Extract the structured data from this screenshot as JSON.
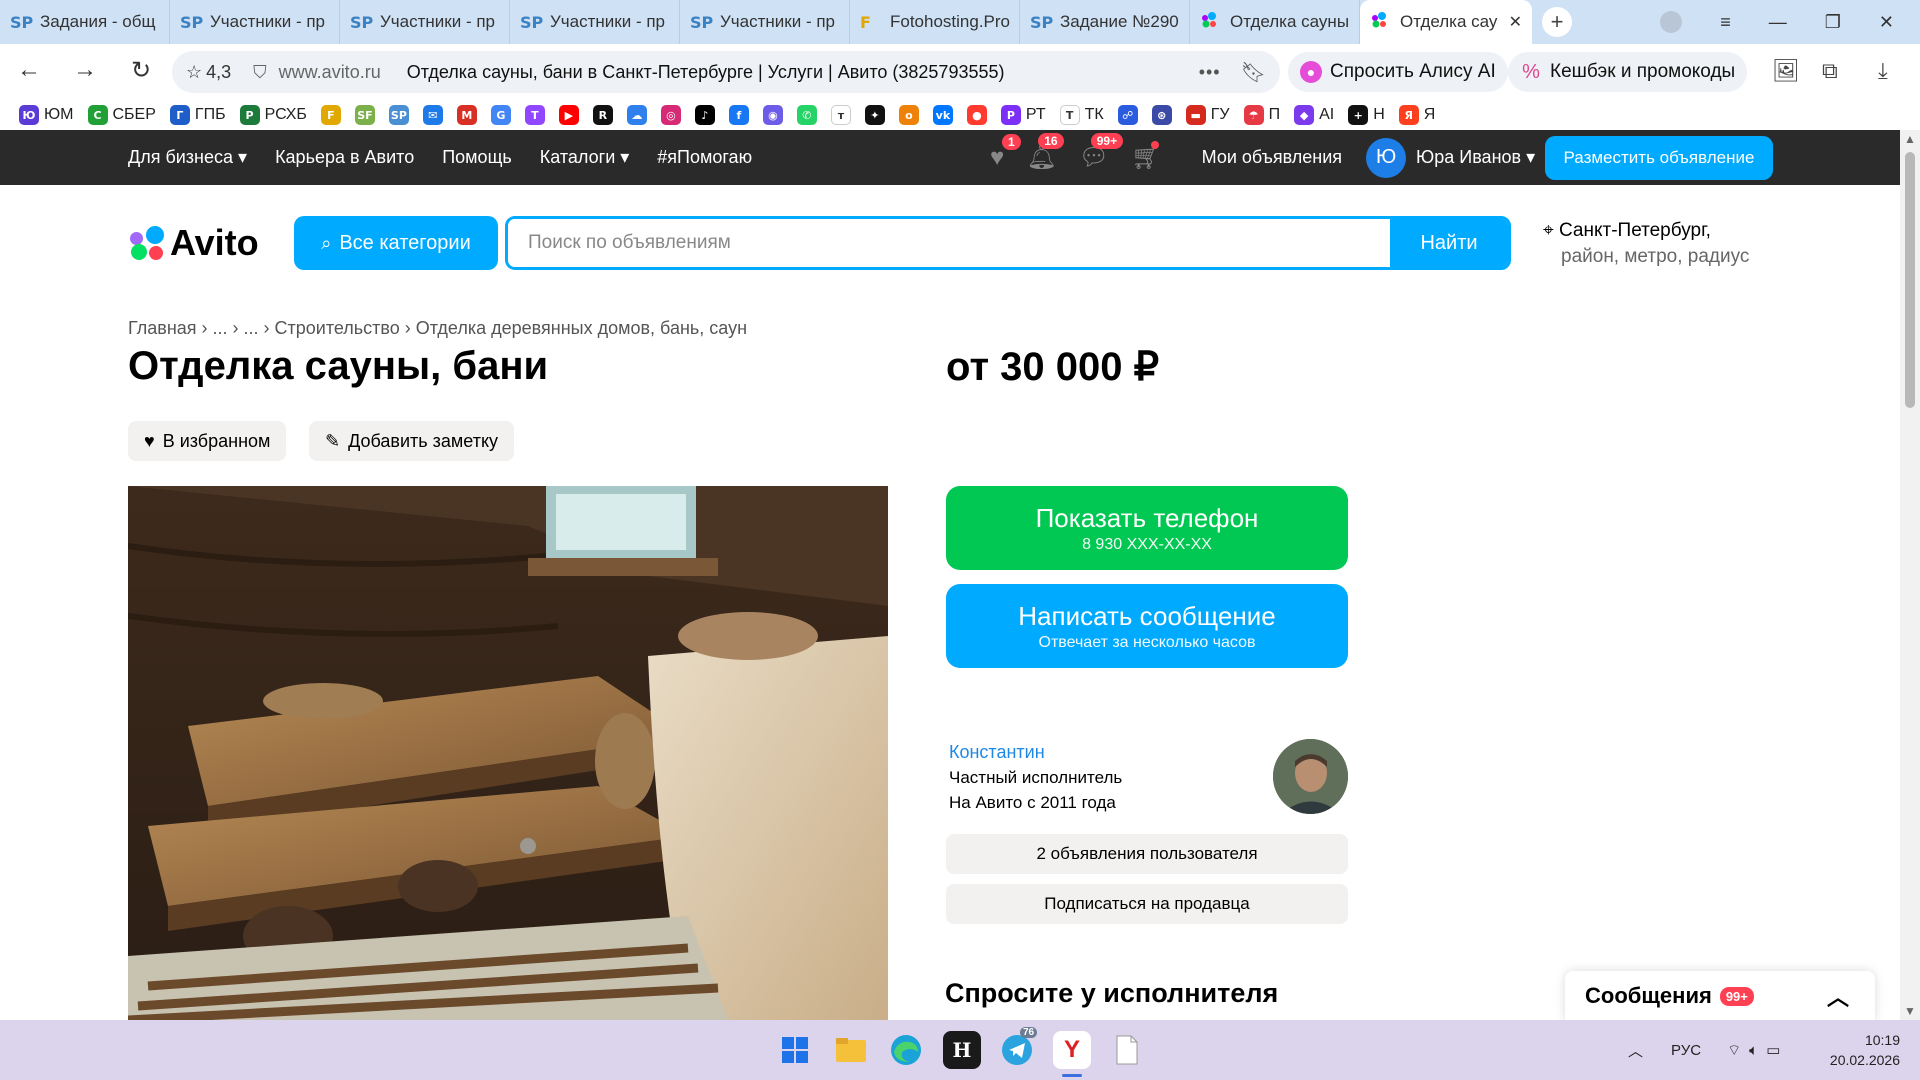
{
  "browser": {
    "tabs": [
      {
        "favicon": "SP",
        "label": "Задания - общ",
        "active": false
      },
      {
        "favicon": "SP",
        "label": "Участники - пр",
        "active": false
      },
      {
        "favicon": "SP",
        "label": "Участники - пр",
        "active": false
      },
      {
        "favicon": "SP",
        "label": "Участники - пр",
        "active": false
      },
      {
        "favicon": "SP",
        "label": "Участники - пр",
        "active": false
      },
      {
        "favicon": "F",
        "label": "Fotohosting.Pro",
        "active": false
      },
      {
        "favicon": "SP",
        "label": "Задание №290",
        "active": false
      },
      {
        "favicon": "avito",
        "label": "Отделка сауны",
        "active": false
      },
      {
        "favicon": "avito",
        "label": "Отделка сау",
        "active": true
      }
    ],
    "new_tab": "+",
    "window_buttons": [
      "profile-icon",
      "menu-icon",
      "minimize-icon",
      "restore-icon",
      "close-icon"
    ],
    "window_glyphs": {
      "menu": "≡",
      "minimize": "—",
      "restore": "❐",
      "close": "✕"
    },
    "address": {
      "rating": "4,3",
      "domain": "www.avito.ru",
      "title": "Отделка сауны, бани в Санкт-Петербурге | Услуги | Авито (3825793555)",
      "more": "•••"
    },
    "alice_label": "Спросить Алису AI",
    "cashback_label": "Кешбэк и промокоды",
    "bookmarks": [
      {
        "icon": "Ю",
        "label": "ЮМ",
        "color": "#5b3bd6"
      },
      {
        "icon": "С",
        "label": "СБЕР",
        "color": "#21a038"
      },
      {
        "icon": "Г",
        "label": "ГПБ",
        "color": "#1f5ec9"
      },
      {
        "icon": "Р",
        "label": "РСХБ",
        "color": "#1c7a3a"
      },
      {
        "icon": "F",
        "label": "",
        "color": "#e0a800"
      },
      {
        "icon": "SF",
        "label": "",
        "color": "#7bb04b"
      },
      {
        "icon": "SP",
        "label": "",
        "color": "#4a8fd4"
      },
      {
        "icon": "✉",
        "label": "",
        "color": "#1e7ae8"
      },
      {
        "icon": "M",
        "label": "",
        "color": "#d93025"
      },
      {
        "icon": "G",
        "label": "",
        "color": "#4285f4"
      },
      {
        "icon": "T",
        "label": "",
        "color": "#9146ff"
      },
      {
        "icon": "▶",
        "label": "",
        "color": "#ff0000"
      },
      {
        "icon": "R",
        "label": "",
        "color": "#111111"
      },
      {
        "icon": "☁",
        "label": "",
        "color": "#2f80ed"
      },
      {
        "icon": "◎",
        "label": "",
        "color": "#d62976"
      },
      {
        "icon": "♪",
        "label": "",
        "color": "#000000"
      },
      {
        "icon": "f",
        "label": "",
        "color": "#1877f2"
      },
      {
        "icon": "◉",
        "label": "",
        "color": "#6d5ce7"
      },
      {
        "icon": "✆",
        "label": "",
        "color": "#25d366"
      },
      {
        "icon": "т",
        "label": "",
        "color": "#ffffff"
      },
      {
        "icon": "✦",
        "label": "",
        "color": "#111111"
      },
      {
        "icon": "о",
        "label": "",
        "color": "#ee8208"
      },
      {
        "icon": "vk",
        "label": "",
        "color": "#0077ff"
      },
      {
        "icon": "●",
        "label": "",
        "color": "#ff3b30"
      },
      {
        "icon": "P",
        "label": "РТ",
        "color": "#7b2ff7"
      },
      {
        "icon": "T",
        "label": "ТК",
        "color": "#ffffff"
      },
      {
        "icon": "☍",
        "label": "",
        "color": "#2b5ce0"
      },
      {
        "icon": "⊛",
        "label": "",
        "color": "#3a4aa6"
      },
      {
        "icon": "▬",
        "label": "ГУ",
        "color": "#d52b1e"
      },
      {
        "icon": "☂",
        "label": "П",
        "color": "#e63946"
      },
      {
        "icon": "◆",
        "label": "AI",
        "color": "#7c3aed"
      },
      {
        "icon": "+",
        "label": "Н",
        "color": "#111111"
      },
      {
        "icon": "Я",
        "label": "Я",
        "color": "#fc3f1d"
      }
    ]
  },
  "site_header": {
    "nav": [
      "Для бизнеса ▾",
      "Карьера в Авито",
      "Помощь",
      "Каталоги ▾",
      "#яПомогаю"
    ],
    "favorites_badge": "1",
    "notifications_badge": "16",
    "messages_badge": "99+",
    "my_ads": "Мои объявления",
    "user_initial": "Ю",
    "user_name": "Юра Иванов ▾",
    "post_ad": "Разместить объявление"
  },
  "search": {
    "logo": "Avito",
    "categories_label": "Все категории",
    "placeholder": "Поиск по объявлениям",
    "find_label": "Найти",
    "city": "Санкт-Петербург,",
    "location_sub": "район, метро, радиус"
  },
  "listing": {
    "breadcrumb": "Главная  ›  ...  ›  ...  ›  Строительство  ›  Отделка деревянных домов, бань, саун",
    "title": "Отделка сауны, бани",
    "price": "от 30 000 ₽",
    "favorite_label": "В избранном",
    "note_label": "Добавить заметку",
    "show_phone": "Показать телефон",
    "phone_masked": "8 930 XXX-XX-XX",
    "write_message": "Написать сообщение",
    "reply_time": "Отвечает за несколько часов",
    "seller_name": "Константин",
    "seller_type": "Частный исполнитель",
    "seller_since": "На Авито с 2011 года",
    "seller_ads": "2 объявления пользователя",
    "subscribe": "Подписаться на продавца",
    "ask_heading": "Спросите у исполнителя"
  },
  "messages_widget": {
    "label": "Сообщения",
    "badge": "99+"
  },
  "taskbar": {
    "telegram_badge": "76",
    "lang": "РУС",
    "time": "10:19",
    "date": "20.02.2026"
  },
  "colors": {
    "avito_blue": "#00aaff",
    "avito_green": "#00c853",
    "header_dark": "#2a2a2a",
    "badge_red": "#ff4053",
    "seller_link": "#1e88e5"
  }
}
